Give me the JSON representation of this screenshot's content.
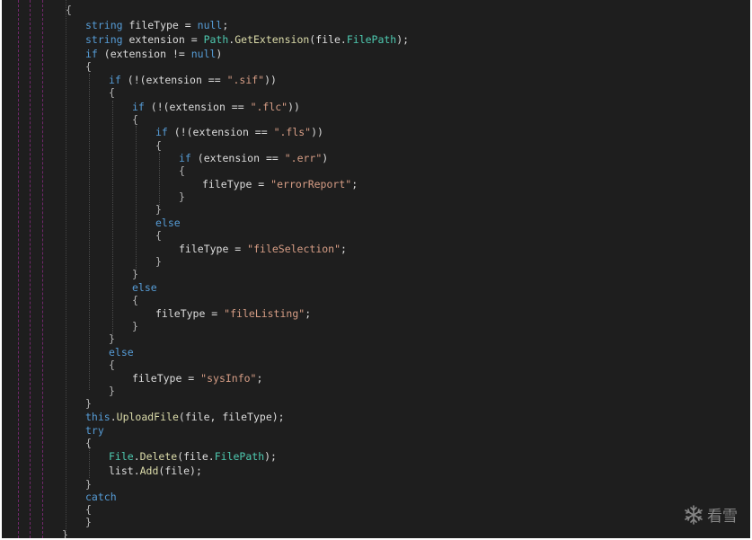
{
  "editor": {
    "lines": [
      [
        {
          "t": "{",
          "c": "brace"
        }
      ],
      [
        {
          "t": "string",
          "c": "kw"
        },
        {
          "t": " fileType = ",
          "c": "plain"
        },
        {
          "t": "null",
          "c": "kw"
        },
        {
          "t": ";",
          "c": "plain"
        }
      ],
      [
        {
          "t": "string",
          "c": "kw"
        },
        {
          "t": " extension = ",
          "c": "plain"
        },
        {
          "t": "Path",
          "c": "type"
        },
        {
          "t": ".",
          "c": "plain"
        },
        {
          "t": "GetExtension",
          "c": "method"
        },
        {
          "t": "(file.",
          "c": "plain"
        },
        {
          "t": "FilePath",
          "c": "prop"
        },
        {
          "t": ");",
          "c": "plain"
        }
      ],
      [
        {
          "t": "if",
          "c": "kw"
        },
        {
          "t": " (extension != ",
          "c": "plain"
        },
        {
          "t": "null",
          "c": "kw"
        },
        {
          "t": ")",
          "c": "plain"
        }
      ],
      [
        {
          "t": "{",
          "c": "brace"
        }
      ],
      [
        {
          "t": "if",
          "c": "kw"
        },
        {
          "t": " (!(extension == ",
          "c": "plain"
        },
        {
          "t": "\".sif\"",
          "c": "str"
        },
        {
          "t": "))",
          "c": "plain"
        }
      ],
      [
        {
          "t": "{",
          "c": "brace"
        }
      ],
      [
        {
          "t": "if",
          "c": "kw"
        },
        {
          "t": " (!(extension == ",
          "c": "plain"
        },
        {
          "t": "\".flc\"",
          "c": "str"
        },
        {
          "t": "))",
          "c": "plain"
        }
      ],
      [
        {
          "t": "{",
          "c": "brace"
        }
      ],
      [
        {
          "t": "if",
          "c": "kw"
        },
        {
          "t": " (!(extension == ",
          "c": "plain"
        },
        {
          "t": "\".fls\"",
          "c": "str"
        },
        {
          "t": "))",
          "c": "plain"
        }
      ],
      [
        {
          "t": "{",
          "c": "brace"
        }
      ],
      [
        {
          "t": "if",
          "c": "kw"
        },
        {
          "t": " (extension == ",
          "c": "plain"
        },
        {
          "t": "\".err\"",
          "c": "str"
        },
        {
          "t": ")",
          "c": "plain"
        }
      ],
      [
        {
          "t": "{",
          "c": "brace"
        }
      ],
      [
        {
          "t": "fileType = ",
          "c": "plain"
        },
        {
          "t": "\"errorReport\"",
          "c": "str"
        },
        {
          "t": ";",
          "c": "plain"
        }
      ],
      [
        {
          "t": "}",
          "c": "brace"
        }
      ],
      [
        {
          "t": "}",
          "c": "brace"
        }
      ],
      [
        {
          "t": "else",
          "c": "kw"
        }
      ],
      [
        {
          "t": "{",
          "c": "brace"
        }
      ],
      [
        {
          "t": "fileType = ",
          "c": "plain"
        },
        {
          "t": "\"fileSelection\"",
          "c": "str"
        },
        {
          "t": ";",
          "c": "plain"
        }
      ],
      [
        {
          "t": "}",
          "c": "brace"
        }
      ],
      [
        {
          "t": "}",
          "c": "brace"
        }
      ],
      [
        {
          "t": "else",
          "c": "kw"
        }
      ],
      [
        {
          "t": "{",
          "c": "brace"
        }
      ],
      [
        {
          "t": "fileType = ",
          "c": "plain"
        },
        {
          "t": "\"fileListing\"",
          "c": "str"
        },
        {
          "t": ";",
          "c": "plain"
        }
      ],
      [
        {
          "t": "}",
          "c": "brace"
        }
      ],
      [
        {
          "t": "}",
          "c": "brace"
        }
      ],
      [
        {
          "t": "else",
          "c": "kw"
        }
      ],
      [
        {
          "t": "{",
          "c": "brace"
        }
      ],
      [
        {
          "t": "fileType = ",
          "c": "plain"
        },
        {
          "t": "\"sysInfo\"",
          "c": "str"
        },
        {
          "t": ";",
          "c": "plain"
        }
      ],
      [
        {
          "t": "}",
          "c": "brace"
        }
      ],
      [
        {
          "t": "}",
          "c": "brace"
        }
      ],
      [
        {
          "t": "this",
          "c": "kw"
        },
        {
          "t": ".",
          "c": "plain"
        },
        {
          "t": "UploadFile",
          "c": "method"
        },
        {
          "t": "(file, fileType);",
          "c": "plain"
        }
      ],
      [
        {
          "t": "try",
          "c": "kw"
        }
      ],
      [
        {
          "t": "{",
          "c": "brace"
        }
      ],
      [
        {
          "t": "File",
          "c": "type"
        },
        {
          "t": ".",
          "c": "plain"
        },
        {
          "t": "Delete",
          "c": "method"
        },
        {
          "t": "(file.",
          "c": "plain"
        },
        {
          "t": "FilePath",
          "c": "prop"
        },
        {
          "t": ");",
          "c": "plain"
        }
      ],
      [
        {
          "t": "list.",
          "c": "plain"
        },
        {
          "t": "Add",
          "c": "method"
        },
        {
          "t": "(file);",
          "c": "plain"
        }
      ],
      [
        {
          "t": "}",
          "c": "brace"
        }
      ],
      [
        {
          "t": "catch",
          "c": "kw"
        }
      ],
      [
        {
          "t": "{",
          "c": "brace"
        }
      ],
      [
        {
          "t": "}",
          "c": "brace"
        }
      ],
      [
        {
          "t": "}",
          "c": "brace"
        }
      ]
    ]
  },
  "watermark": {
    "text": "看雪",
    "icon": "snowflake-icon"
  },
  "colors": {
    "background": "#1e1e1e",
    "keyword": "#569cd6",
    "type": "#4ec9b0",
    "method": "#dcdcaa",
    "string": "#d69d85",
    "plain": "#dcdcdc",
    "guide": "#7a2a74"
  }
}
